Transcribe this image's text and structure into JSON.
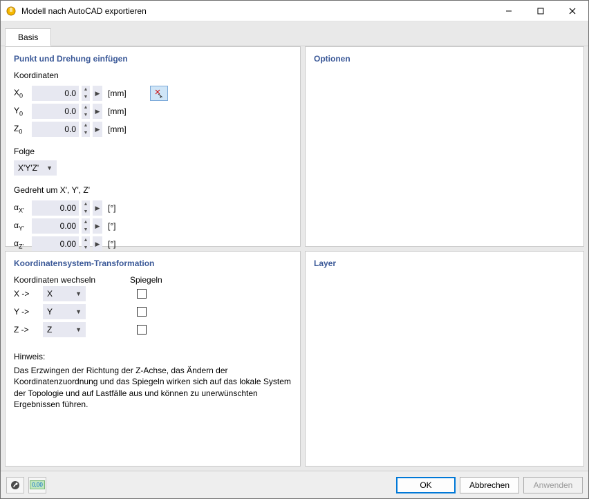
{
  "window": {
    "title": "Modell nach AutoCAD exportieren"
  },
  "tabs": {
    "active": "Basis"
  },
  "panels": {
    "insert": {
      "title": "Punkt und Drehung einfügen",
      "coord_label": "Koordinaten",
      "x": {
        "label": "X",
        "sub": "0",
        "value": "0.0",
        "unit": "[mm]"
      },
      "y": {
        "label": "Y",
        "sub": "0",
        "value": "0.0",
        "unit": "[mm]"
      },
      "z": {
        "label": "Z",
        "sub": "0",
        "value": "0.0",
        "unit": "[mm]"
      },
      "seq_label": "Folge",
      "seq_value": "X'Y'Z'",
      "rot_label": "Gedreht um X', Y', Z'",
      "ax": {
        "label": "α",
        "sub": "X'",
        "value": "0.00",
        "unit": "[°]"
      },
      "ay": {
        "label": "α",
        "sub": "Y'",
        "value": "0.00",
        "unit": "[°]"
      },
      "az": {
        "label": "α",
        "sub": "Z'",
        "value": "0.00",
        "unit": "[°]"
      }
    },
    "transform": {
      "title": "Koordinatensystem-Transformation",
      "swap_label": "Koordinaten wechseln",
      "mirror_label": "Spiegeln",
      "rows": {
        "x": {
          "from": "X ->",
          "to": "X"
        },
        "y": {
          "from": "Y ->",
          "to": "Y"
        },
        "z": {
          "from": "Z ->",
          "to": "Z"
        }
      },
      "hint_title": "Hinweis:",
      "hint_body": "Das Erzwingen der Richtung der Z-Achse, das Ändern der Koordinatenzuordnung und das Spiegeln wirken sich auf das lokale System der Topologie und auf Lastfälle aus und können zu unerwünschten Ergebnissen führen."
    },
    "options": {
      "title": "Optionen"
    },
    "layer": {
      "title": "Layer"
    }
  },
  "footer": {
    "ok": "OK",
    "cancel": "Abbrechen",
    "apply": "Anwenden",
    "units_icon_text": "0,00"
  }
}
